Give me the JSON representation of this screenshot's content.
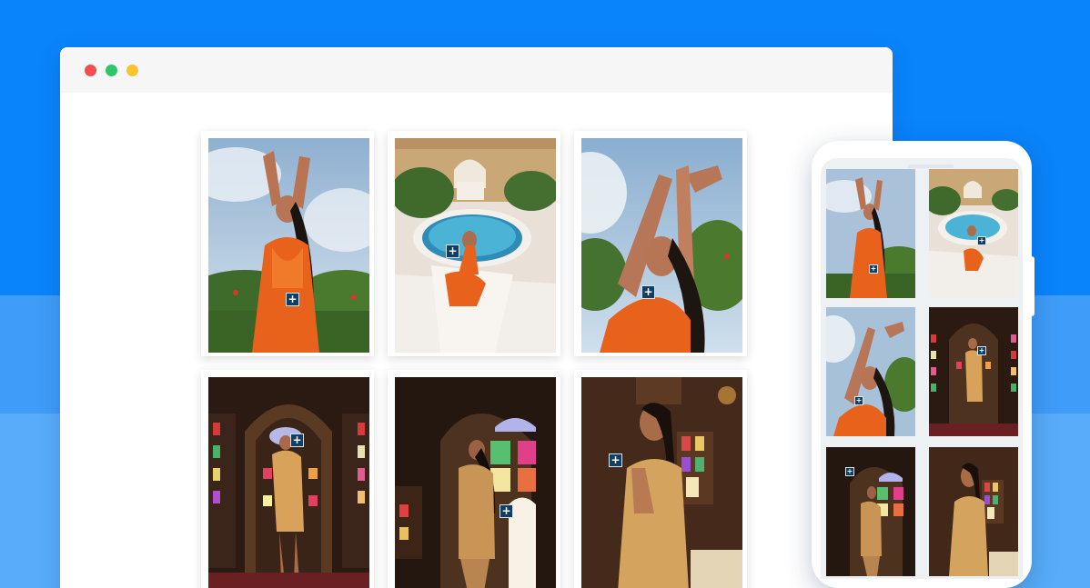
{
  "colors": {
    "background": "#0a84fb",
    "window_dot_close": "#f24e4e",
    "window_dot_maximize": "#2fc56b",
    "window_dot_minimize": "#f7c42f",
    "plus_badge": "#0f3e66",
    "dress_orange": "#e8621c"
  },
  "gallery": {
    "plus_symbol": "+",
    "photos": [
      {
        "scene": "sky-arms-raised"
      },
      {
        "scene": "poolside"
      },
      {
        "scene": "sky-closeup"
      },
      {
        "scene": "palace-arch"
      },
      {
        "scene": "palace-window"
      },
      {
        "scene": "dim-room-portrait"
      }
    ]
  },
  "mobile": {
    "plus_symbol": "+"
  }
}
